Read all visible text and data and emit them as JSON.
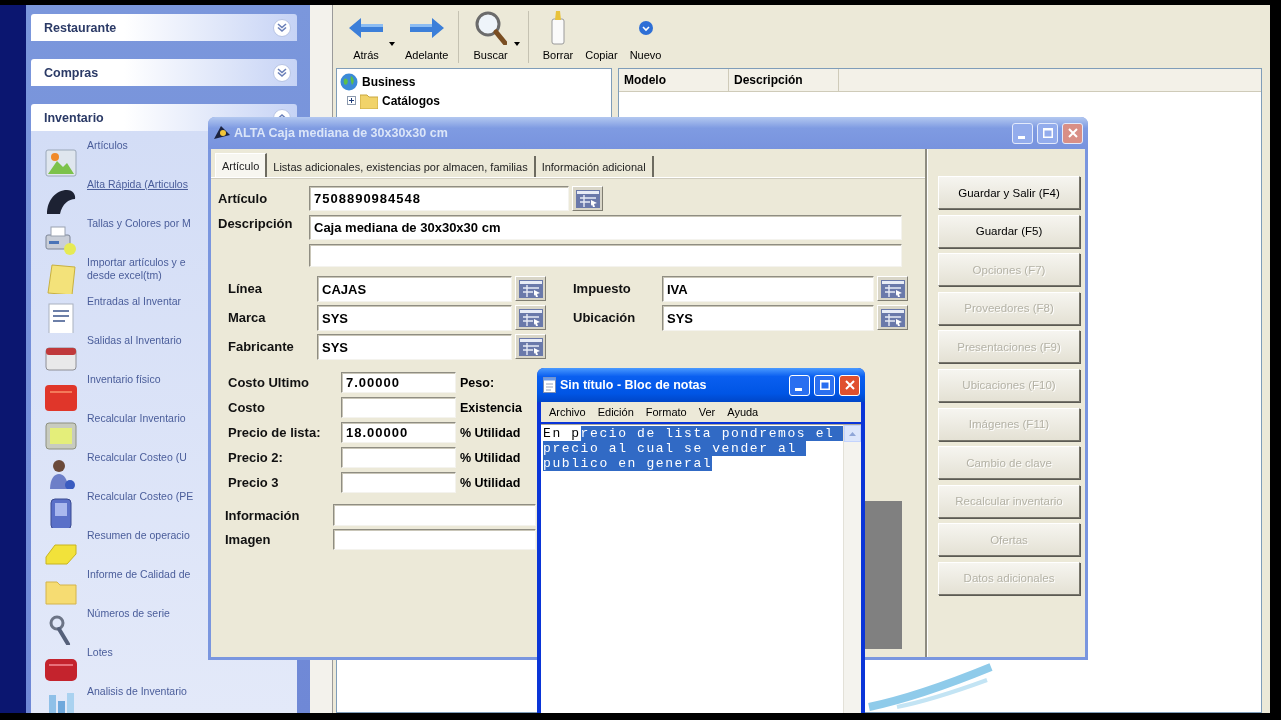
{
  "task_pane": {
    "groups": [
      {
        "title": "Restaurante",
        "expanded": false
      },
      {
        "title": "Compras",
        "expanded": false
      },
      {
        "title": "Inventario",
        "expanded": true,
        "items": [
          {
            "label": "Artículos",
            "hovered": false
          },
          {
            "label": "Alta Rápida (Articulos",
            "hovered": true
          },
          {
            "label": "Tallas y Colores por M",
            "hovered": false
          },
          {
            "label": "Importar artículos y e\ndesde excel(tm)",
            "hovered": false
          },
          {
            "label": "Entradas al Inventar",
            "hovered": false
          },
          {
            "label": "Salidas al Inventario",
            "hovered": false
          },
          {
            "label": "Inventario físico",
            "hovered": false
          },
          {
            "label": "Recalcular Inventario",
            "hovered": false
          },
          {
            "label": "Recalcular Costeo (U",
            "hovered": false
          },
          {
            "label": "Recalcular Costeo (PE",
            "hovered": false
          },
          {
            "label": "Resumen de operacio",
            "hovered": false
          },
          {
            "label": "Informe de Calidad de",
            "hovered": false
          },
          {
            "label": "Números de serie",
            "hovered": false
          },
          {
            "label": "Lotes",
            "hovered": false
          },
          {
            "label": "Analisis de Inventario",
            "hovered": false
          }
        ]
      }
    ]
  },
  "explorer": {
    "toolbar_groups": [
      [
        {
          "label": "Atrás",
          "kind": "back",
          "dropdown": true
        },
        {
          "label": "Adelante",
          "kind": "forward",
          "dropdown": false
        }
      ],
      [
        {
          "label": "Buscar",
          "kind": "search",
          "dropdown": true
        }
      ],
      [
        {
          "label": "Borrar",
          "kind": "delete",
          "dropdown": false
        },
        {
          "label": "Copiar",
          "kind": "copy",
          "dropdown": false
        },
        {
          "label": "Nuevo",
          "kind": "new",
          "dropdown": false
        }
      ]
    ],
    "tree": [
      {
        "label": "Business",
        "children": [
          {
            "label": "Catálogos",
            "expanded": false
          }
        ]
      }
    ],
    "columns": [
      "Modelo",
      "Descripción"
    ]
  },
  "dialog": {
    "title": "ALTA Caja mediana de 30x30x30 cm",
    "active": false,
    "tabs": [
      {
        "label": "Artículo",
        "selected": true
      },
      {
        "label": "Listas adicionales, existencias por almacen, familias",
        "selected": false
      },
      {
        "label": "Información adicional",
        "selected": false
      }
    ],
    "code": {
      "label": "Artículo",
      "value": "7508890984548"
    },
    "description": {
      "label": "Descripción",
      "value": "Caja mediana de 30x30x30 cm"
    },
    "left_fields": [
      {
        "label": "Línea",
        "value": "CAJAS"
      },
      {
        "label": "Marca",
        "value": "SYS"
      },
      {
        "label": "Fabricante",
        "value": "SYS"
      }
    ],
    "right_fields": [
      {
        "label": "Impuesto",
        "value": "IVA"
      },
      {
        "label": "Ubicación",
        "value": "SYS"
      }
    ],
    "prices": [
      {
        "label": "Costo Ultimo",
        "value": "7.00000",
        "side_label": "Peso:"
      },
      {
        "label": "Costo",
        "side_label": "Existencia"
      },
      {
        "label": "Precio de lista:",
        "value": "18.00000",
        "side_label": "% Utilidad"
      },
      {
        "label": "Precio 2:",
        "side_label": "% Utilidad"
      },
      {
        "label": "Precio 3",
        "side_label": "% Utilidad"
      }
    ],
    "extra_fields": [
      {
        "label": "Información"
      },
      {
        "label": "Imagen"
      }
    ],
    "buttons": [
      {
        "label": "Guardar y Salir (F4)",
        "disabled": false
      },
      {
        "label": "Guardar (F5)",
        "disabled": false
      },
      {
        "label": "Opciones (F7)",
        "disabled": true
      },
      {
        "label": "Proveedores (F8)",
        "disabled": true
      },
      {
        "label": "Presentaciones (F9)",
        "disabled": true
      },
      {
        "label": "Ubicaciones (F10)",
        "disabled": true
      },
      {
        "label": "Imágenes (F11)",
        "disabled": true
      },
      {
        "label": "Cambio de clave",
        "disabled": true
      },
      {
        "label": "Recalcular inventario",
        "disabled": true
      },
      {
        "label": "Ofertas",
        "disabled": true
      },
      {
        "label": "Datos adicionales",
        "disabled": true
      }
    ]
  },
  "notepad": {
    "title": "Sin título - Bloc de notas",
    "active": true,
    "menu": [
      "Archivo",
      "Edición",
      "Formato",
      "Ver",
      "Ayuda"
    ],
    "text_before_selection": "En p",
    "selected_text": "recio de lista pondremos el precio al cual se vender al publico en general"
  }
}
